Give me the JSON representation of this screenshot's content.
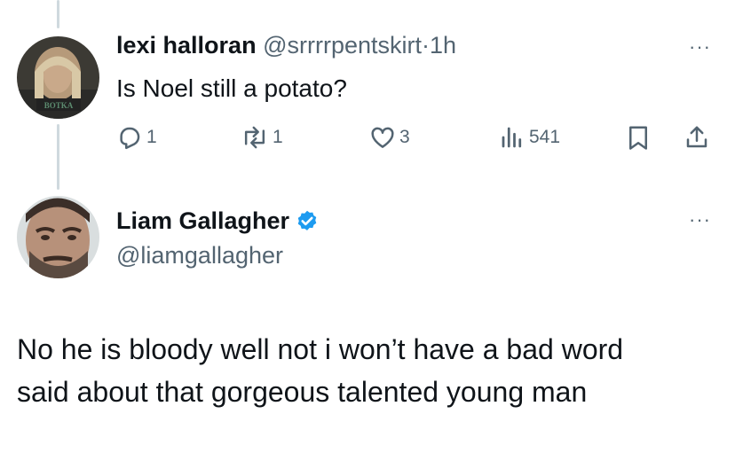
{
  "reply": {
    "display_name": "lexi halloran",
    "handle": "@srrrrpentskirt",
    "separator": "·",
    "time": "1h",
    "text": "Is Noel still a potato?",
    "avatar_caption": "",
    "actions": {
      "replies": "1",
      "retweets": "1",
      "likes": "3",
      "views": "541"
    },
    "icons": [
      "reply-icon",
      "retweet-icon",
      "like-icon",
      "views-icon",
      "bookmark-icon",
      "share-icon",
      "more-icon"
    ]
  },
  "main_tweet": {
    "display_name": "Liam Gallagher",
    "handle": "@liamgallagher",
    "verified": true,
    "text_line1": "No he is bloody well not i won’t have a bad word",
    "text_line2": "said about that gorgeous talented young man"
  },
  "more_label": "···",
  "colors": {
    "text": "#0f1419",
    "muted": "#536471",
    "verified": "#1d9bf0",
    "thread_line": "#cfd9de"
  }
}
